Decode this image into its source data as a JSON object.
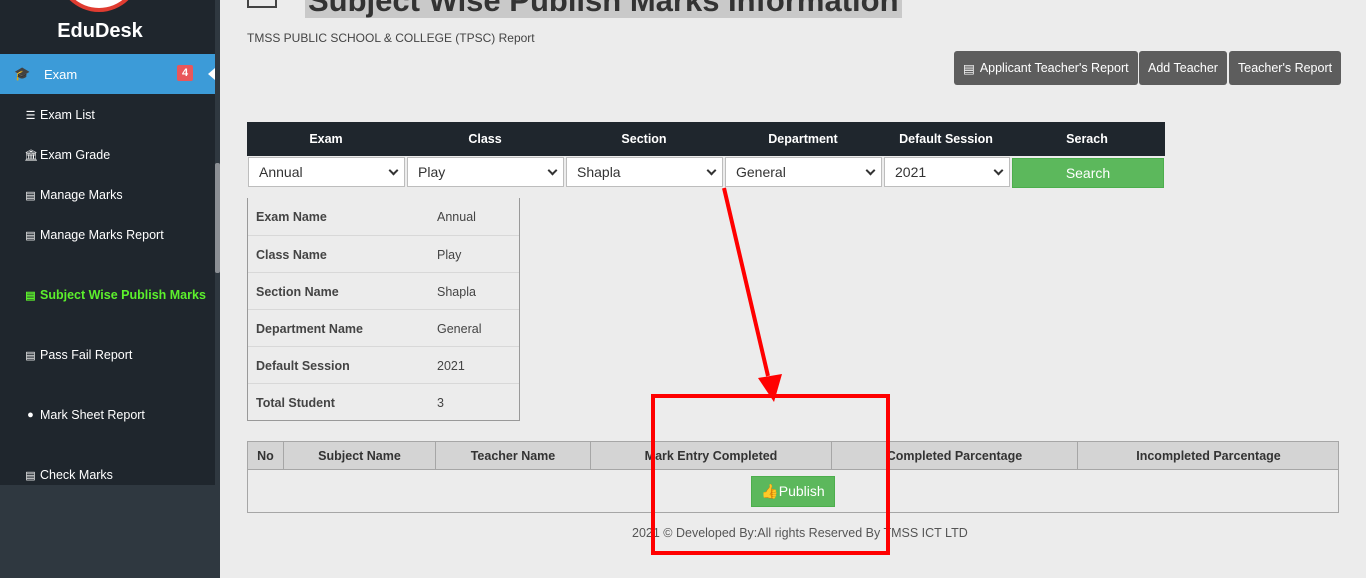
{
  "sidebar": {
    "brand": "EduDesk",
    "active_section": {
      "label": "Exam",
      "badge": "4"
    },
    "items": [
      {
        "label": "Exam List",
        "icon": "list-icon"
      },
      {
        "label": "Exam Grade",
        "icon": "bank-icon"
      },
      {
        "label": "Manage Marks",
        "icon": "document-icon"
      },
      {
        "label": "Manage Marks Report",
        "icon": "document-icon"
      },
      {
        "label": "Subject Wise Publish Marks",
        "icon": "document-icon",
        "active": true
      },
      {
        "label": "Pass Fail Report",
        "icon": "document-icon"
      },
      {
        "label": "Mark Sheet Report",
        "icon": "circle-icon"
      },
      {
        "label": "Check Marks",
        "icon": "document-icon"
      }
    ]
  },
  "header": {
    "title": "Subject Wise Publish Marks Information",
    "subtitle": "TMSS PUBLIC SCHOOL & COLLEGE (TPSC) Report"
  },
  "actions": {
    "applicant_report": "Applicant Teacher's Report",
    "add_teacher": "Add Teacher",
    "teacher_report": "Teacher's Report"
  },
  "filters": {
    "headers": [
      "Exam",
      "Class",
      "Section",
      "Department",
      "Default Session",
      "Serach"
    ],
    "exam": "Annual",
    "class": "Play",
    "section": "Shapla",
    "department": "General",
    "session": "2021",
    "search_label": "Search"
  },
  "info": [
    {
      "key": "Exam Name",
      "value": "Annual"
    },
    {
      "key": "Class Name",
      "value": "Play"
    },
    {
      "key": "Section Name",
      "value": "Shapla"
    },
    {
      "key": "Department Name",
      "value": "General"
    },
    {
      "key": "Default Session",
      "value": "2021"
    },
    {
      "key": "Total Student",
      "value": "3"
    }
  ],
  "subject_table": {
    "headers": [
      "No",
      "Subject Name",
      "Teacher Name",
      "Mark Entry Completed",
      "Completed Parcentage",
      "Incompleted Parcentage"
    ],
    "publish_label": "Publish"
  },
  "footer": "2021 © Developed By:All rights Reserved By TMSS ICT LTD",
  "colors": {
    "sidebar_bg": "#1f262d",
    "active_blue": "#3c9bd8",
    "success_green": "#5cb85c",
    "active_text": "#5cf02c",
    "annotation_red": "#ff0000"
  }
}
